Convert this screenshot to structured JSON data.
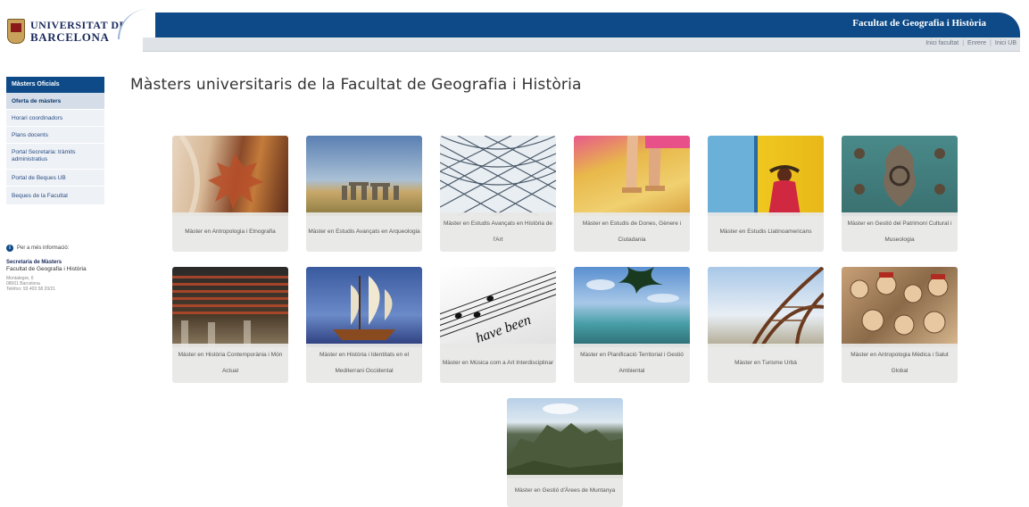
{
  "header": {
    "logo_line1": "UNIVERSITAT DE",
    "logo_line2": "BARCELONA",
    "faculty_title": "Facultat de Geografia i Història",
    "top_links": [
      "Inici facultat",
      "Enrere",
      "Inici UB"
    ]
  },
  "sidebar": {
    "heading": "Màsters Oficials",
    "items": [
      {
        "label": "Oferta de màsters"
      },
      {
        "label": "Horari coordinadors"
      },
      {
        "label": "Plans docents"
      },
      {
        "label": "Portal Secretaria: tràmits administratius"
      },
      {
        "label": "Portal de Beques UB"
      },
      {
        "label": "Beques de la Facultat"
      }
    ],
    "info_text": "Per a més informació:",
    "contact": {
      "title": "Secretaria de Màsters",
      "faculty": "Facultat de Geografia i Història",
      "address1": "Montalegre, 6",
      "address2": "08001 Barcelona",
      "phone": "Telèfon: 93 403 58 20/21"
    }
  },
  "main": {
    "title": "Màsters universitaris de la Facultat de Geografia i Història",
    "masters": [
      {
        "label": "Màster en Antropologia i Etnografia",
        "icon": "autumn-leaves-image"
      },
      {
        "label": "Màster en Estudis Avançats en Arqueologia",
        "icon": "stonehenge-image"
      },
      {
        "label": "Màster en Estudis Avançats en Història de l'Art",
        "icon": "glass-dome-image"
      },
      {
        "label": "Màster en Estudis de Dones, Gènere i Ciutadania",
        "icon": "sandals-image"
      },
      {
        "label": "Màster en Estudis Llatinoamericans",
        "icon": "latin-woman-image"
      },
      {
        "label": "Màster en Gestió del Patrimoni Cultural i Museologia",
        "icon": "door-knocker-image"
      },
      {
        "label": "Màster en Història Contemporània i Món Actual",
        "icon": "departure-board-image"
      },
      {
        "label": "Màster en Història i Identitats en el Mediterrani Occidental",
        "icon": "sailing-ship-image"
      },
      {
        "label": "Màster en Música com a Art Interdisciplinar",
        "icon": "sheet-music-image"
      },
      {
        "label": "Màster en Planificació Territorial i Gestió Ambiental",
        "icon": "beach-image"
      },
      {
        "label": "Màster en Turisme Urbà",
        "icon": "eiffel-tower-image"
      },
      {
        "label": "Màster en Antropologia Mèdica i Salut Global",
        "icon": "crowd-painting-image"
      },
      {
        "label": "Màster en Gestió d'Àrees de Muntanya",
        "icon": "mountain-image"
      }
    ]
  }
}
